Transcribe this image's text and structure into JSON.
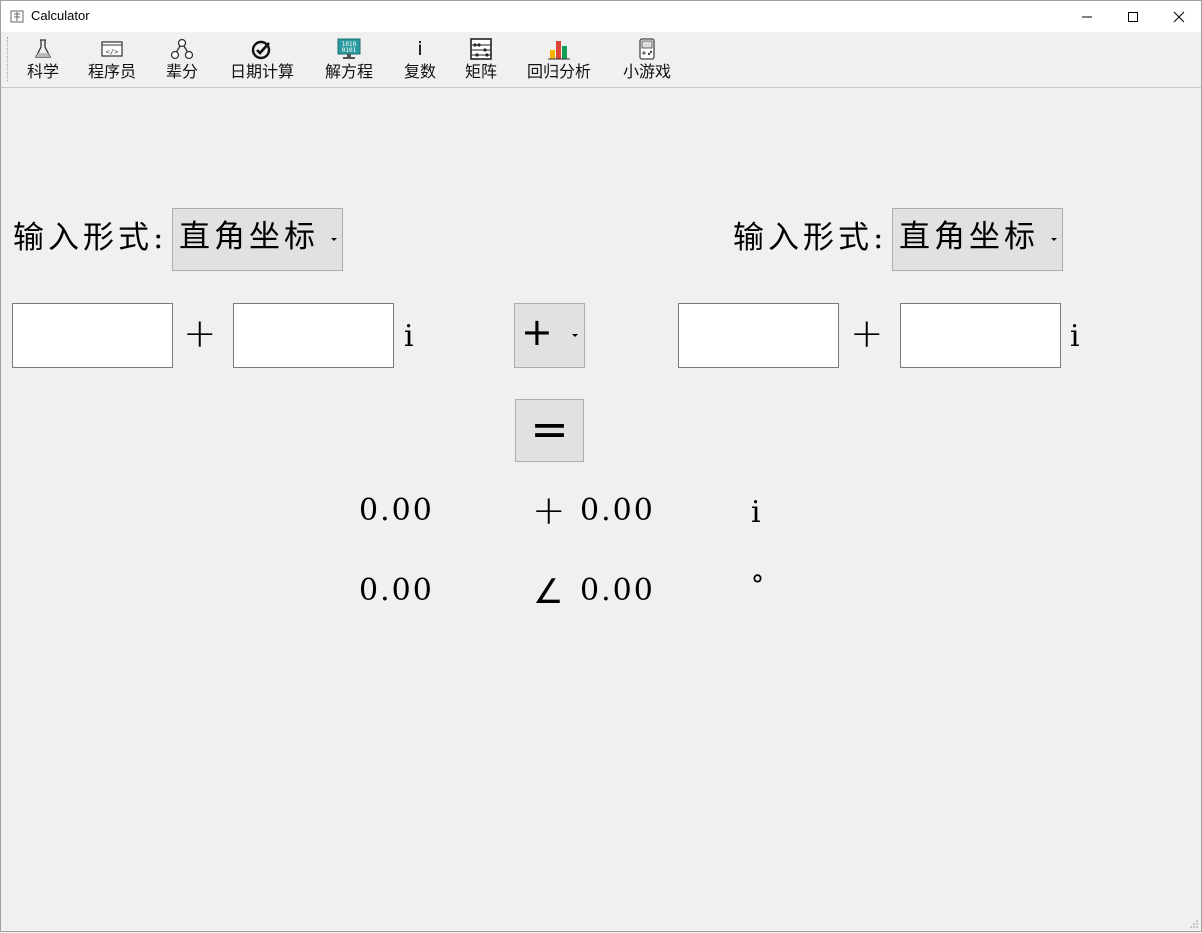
{
  "window": {
    "title": "Calculator",
    "minimize_glyph": "—",
    "maximize_glyph": "☐",
    "close_glyph": "✕"
  },
  "toolbar": {
    "items": [
      {
        "label": "科学",
        "icon": "flask-icon"
      },
      {
        "label": "程序员",
        "icon": "code-window-icon"
      },
      {
        "label": "辈分",
        "icon": "family-tree-icon"
      },
      {
        "label": "日期计算",
        "icon": "calendar-check-icon"
      },
      {
        "label": "解方程",
        "icon": "monitor-binary-icon"
      },
      {
        "label": "复数",
        "icon": "imaginary-i-icon",
        "glyph": "i"
      },
      {
        "label": "矩阵",
        "icon": "abacus-icon"
      },
      {
        "label": "回归分析",
        "icon": "bar-chart-icon"
      },
      {
        "label": "小游戏",
        "icon": "gameboy-icon"
      }
    ]
  },
  "left_operand": {
    "input_form_label": "输入形式:",
    "input_form_selected": "直角坐标",
    "real_value": "",
    "plus_sign": "+",
    "imag_value": "",
    "imag_unit": "i"
  },
  "operator": {
    "selected": "+"
  },
  "right_operand": {
    "input_form_label": "输入形式:",
    "input_form_selected": "直角坐标",
    "real_value": "",
    "plus_sign": "+",
    "imag_value": "",
    "imag_unit": "i"
  },
  "equals_label": "=",
  "result": {
    "rect_real": "0.00",
    "rect_sign": "+",
    "rect_imag": "0.00",
    "rect_unit": "i",
    "polar_magnitude": "0.00",
    "polar_sign": "∠",
    "polar_angle": "0.00",
    "polar_unit": "°"
  },
  "colors": {
    "window_bg": "#f0f0f0",
    "button_bg": "#e1e1e1",
    "button_border": "#adadad"
  }
}
